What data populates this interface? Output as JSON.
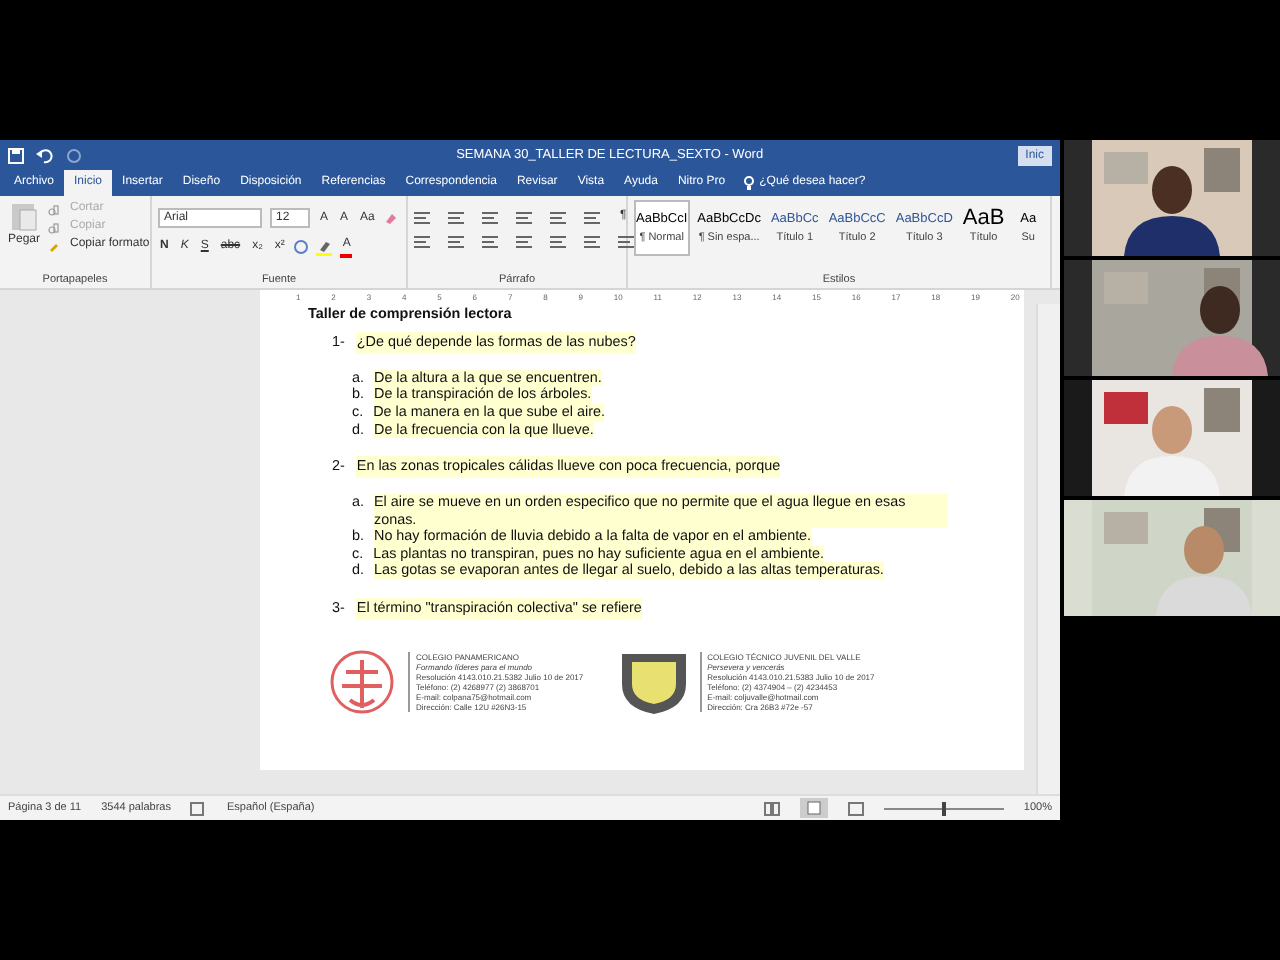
{
  "window": {
    "title": "SEMANA 30_TALLER DE LECTURA_SEXTO  -  Word",
    "sign_in": "Inic"
  },
  "tabs": [
    {
      "label": "Archivo",
      "selected": false
    },
    {
      "label": "Inicio",
      "selected": true
    },
    {
      "label": "Insertar",
      "selected": false
    },
    {
      "label": "Diseño",
      "selected": false
    },
    {
      "label": "Disposición",
      "selected": false
    },
    {
      "label": "Referencias",
      "selected": false
    },
    {
      "label": "Correspondencia",
      "selected": false
    },
    {
      "label": "Revisar",
      "selected": false
    },
    {
      "label": "Vista",
      "selected": false
    },
    {
      "label": "Ayuda",
      "selected": false
    },
    {
      "label": "Nitro Pro",
      "selected": false
    }
  ],
  "tell_me": "¿Qué desea hacer?",
  "clipboard": {
    "paste": "Pegar",
    "items": [
      {
        "label": "Cortar",
        "disabled": true
      },
      {
        "label": "Copiar",
        "disabled": true
      },
      {
        "label": "Copiar formato",
        "disabled": false
      }
    ],
    "group": "Portapapeles"
  },
  "font": {
    "name": "Arial",
    "size": "12",
    "grow": "A",
    "shrink": "A",
    "case": "Aa",
    "buttons": [
      "N",
      "K",
      "S",
      "abc",
      "x₂",
      "x²"
    ],
    "color_letter": "A",
    "group": "Fuente"
  },
  "paragraph": {
    "group": "Párrafo",
    "mark": "¶"
  },
  "styles": {
    "group": "Estilos",
    "items": [
      {
        "sample": "AaBbCcI",
        "label": "¶ Normal",
        "selected": true
      },
      {
        "sample": "AaBbCcDc",
        "label": "¶ Sin espa...",
        "selected": false
      },
      {
        "sample": "AaBbCc",
        "label": "Título 1",
        "selected": false
      },
      {
        "sample": "AaBbCcC",
        "label": "Título 2",
        "selected": false
      },
      {
        "sample": "AaBbCcD",
        "label": "Título 3",
        "selected": false
      },
      {
        "sample": "AaB",
        "label": "Título",
        "selected": false
      },
      {
        "sample": "Aa",
        "label": "Su",
        "selected": false
      }
    ]
  },
  "ruler": [
    "1",
    "2",
    "3",
    "4",
    "5",
    "6",
    "7",
    "8",
    "9",
    "10",
    "11",
    "12",
    "13",
    "14",
    "15",
    "16",
    "17",
    "18",
    "19",
    "20"
  ],
  "document": {
    "heading": "Taller de comprensión lectora",
    "questions": [
      {
        "number": "1-",
        "text": "¿De qué depende las formas de las nubes?",
        "options": [
          {
            "letter": "a.",
            "text": "De la altura a la que se encuentren."
          },
          {
            "letter": "b.",
            "text": "De la transpiración de los árboles."
          },
          {
            "letter": "c.",
            "text": "De la manera en la que sube el aire."
          },
          {
            "letter": "d.",
            "text": "De la frecuencia con la que llueve."
          }
        ]
      },
      {
        "number": "2-",
        "text": "En las zonas tropicales cálidas llueve con poca frecuencia, porque",
        "options": [
          {
            "letter": "a.",
            "text": "El aire se mueve en un orden especifico que no permite que el agua llegue en esas zonas."
          },
          {
            "letter": "b.",
            "text": "No hay formación de lluvia debido a la falta de vapor en el ambiente."
          },
          {
            "letter": "c.",
            "text": "Las plantas no transpiran, pues no hay suficiente agua en el ambiente."
          },
          {
            "letter": "d.",
            "text": "Las gotas se evaporan antes de llegar al suelo, debido a las altas temperaturas."
          }
        ]
      },
      {
        "number": "3-",
        "text": "El término \"transpiración colectiva\" se refiere"
      }
    ],
    "schools": [
      {
        "kind": "emblem",
        "name": "COLEGIO PANAMERICANO",
        "motto": "Formando líderes para el mundo",
        "lines": [
          "Resolución 4143.010.21.5382 Julio 10 de 2017",
          "Teléfono: (2) 4268977 (2) 3868701",
          "E-mail: colpana75@hotmail.com",
          "Dirección: Calle 12U #26N3-15"
        ]
      },
      {
        "kind": "shield",
        "name": "COLEGIO TÉCNICO JUVENIL DEL VALLE",
        "motto": "Persevera y vencerás",
        "lines": [
          "Resolución 4143.010.21.5383 Julio 10 de 2017",
          "Teléfono: (2) 4374904 – (2) 4234453",
          "E-mail: coljuvalle@hotmail.com",
          "Dirección: Cra 26B3 #72e -57"
        ]
      }
    ]
  },
  "status_bar": {
    "page": "Página 3 de 11",
    "words": "3544 palabras",
    "language": "Español (España)",
    "zoom": {
      "level": 0.5
    },
    "zoom_text": "100%"
  }
}
